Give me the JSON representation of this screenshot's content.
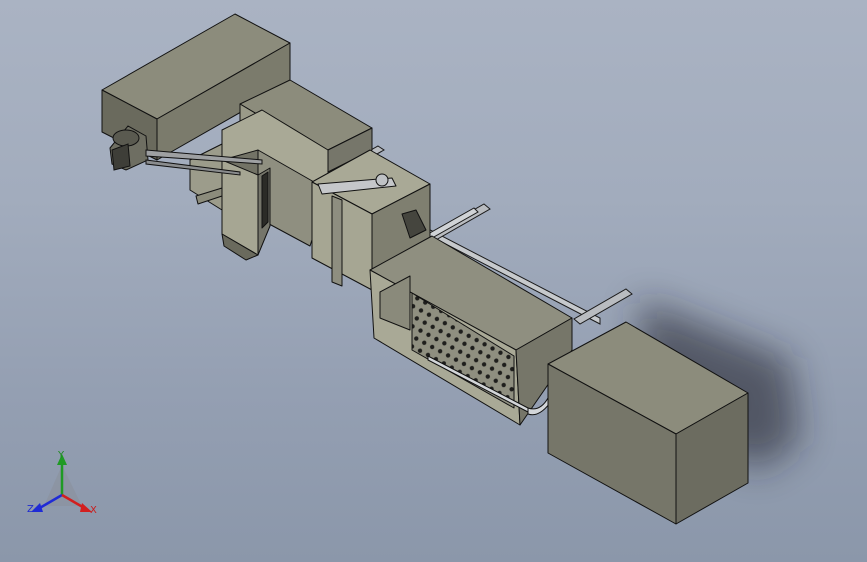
{
  "viewport": {
    "background_top": "#aab3c3",
    "background_bottom": "#8b97aa"
  },
  "model": {
    "body_color": "#7e7e6f",
    "face_light": "#a9a996",
    "face_dark": "#6a6a5d",
    "edge_color": "#141414",
    "rail_color": "#b9bcc0"
  },
  "triad": {
    "labels": {
      "x": "X",
      "y": "Y",
      "z": "Z"
    },
    "colors": {
      "x": "#d21f1f",
      "y": "#1f9a24",
      "z": "#1f2bd6"
    }
  }
}
